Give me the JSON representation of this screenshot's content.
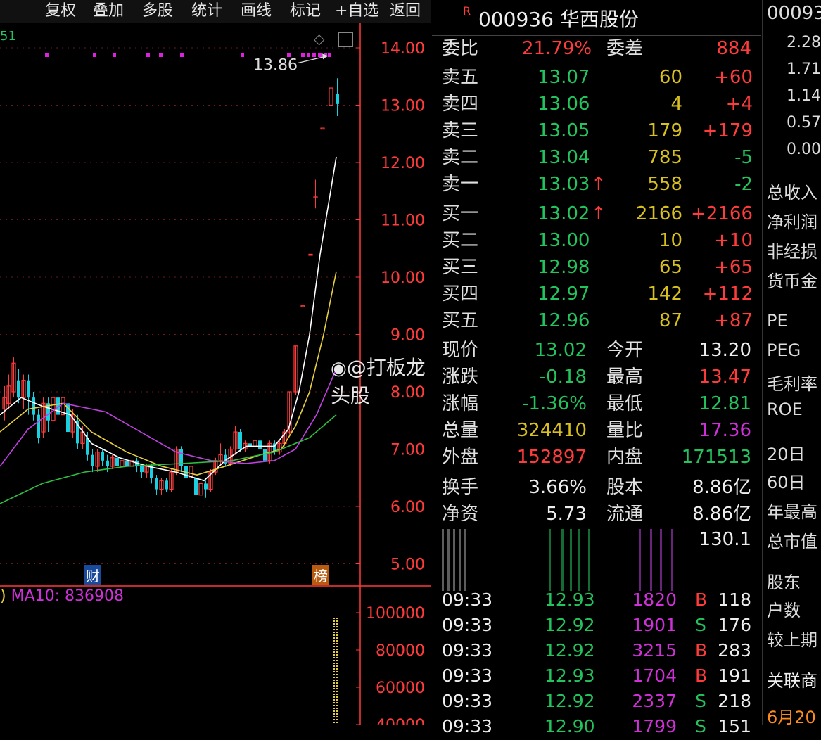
{
  "toolbar": {
    "buttons": [
      "复权",
      "叠加",
      "多股",
      "统计",
      "画线",
      "标记",
      "+自选",
      "返回"
    ]
  },
  "chart": {
    "price_ticks": [
      "14.00",
      "13.00",
      "12.00",
      "11.00",
      "10.00",
      "9.00",
      "8.00",
      "7.00",
      "6.00",
      "5.00"
    ],
    "high_label": "13.86",
    "corner_fragment": "51",
    "badge_cai": "财",
    "badge_bang": "榜",
    "indicator_label": "MA10: 836908",
    "volume_ticks": [
      "100000",
      "80000",
      "60000",
      "40000"
    ],
    "watermark": "@打板龙头股",
    "colors": {
      "up": "#ff3b3b",
      "down": "#1ad0e0",
      "ma5": "#ffffff",
      "ma10": "#e8d040",
      "ma20": "#c040e0",
      "ma60": "#30c040",
      "axis": "#ff3b3b"
    }
  },
  "quote": {
    "code_name": "000936 华西股份",
    "r_mark": "R",
    "weibi_label": "委比",
    "weibi_value": "21.79%",
    "weicha_label": "委差",
    "weicha_value": "884",
    "asks": [
      {
        "label": "卖五",
        "price": "13.07",
        "vol": "60",
        "chg": "+60",
        "arrow": ""
      },
      {
        "label": "卖四",
        "price": "13.06",
        "vol": "4",
        "chg": "+4",
        "arrow": ""
      },
      {
        "label": "卖三",
        "price": "13.05",
        "vol": "179",
        "chg": "+179",
        "arrow": ""
      },
      {
        "label": "卖二",
        "price": "13.04",
        "vol": "785",
        "chg": "-5",
        "arrow": ""
      },
      {
        "label": "卖一",
        "price": "13.03",
        "vol": "558",
        "chg": "-2",
        "arrow": "↑"
      }
    ],
    "bids": [
      {
        "label": "买一",
        "price": "13.02",
        "vol": "2166",
        "chg": "+2166",
        "arrow": "↑"
      },
      {
        "label": "买二",
        "price": "13.00",
        "vol": "10",
        "chg": "+10",
        "arrow": ""
      },
      {
        "label": "买三",
        "price": "12.98",
        "vol": "65",
        "chg": "+65",
        "arrow": ""
      },
      {
        "label": "买四",
        "price": "12.97",
        "vol": "142",
        "chg": "+112",
        "arrow": ""
      },
      {
        "label": "买五",
        "price": "12.96",
        "vol": "87",
        "chg": "+87",
        "arrow": ""
      }
    ],
    "stats": [
      {
        "l1": "现价",
        "v1": "13.02",
        "l2": "今开",
        "v2": "13.20"
      },
      {
        "l1": "涨跌",
        "v1": "-0.18",
        "l2": "最高",
        "v2": "13.47"
      },
      {
        "l1": "涨幅",
        "v1": "-1.36%",
        "l2": "最低",
        "v2": "12.81"
      },
      {
        "l1": "总量",
        "v1": "324410",
        "l2": "量比",
        "v2": "17.36"
      },
      {
        "l1": "外盘",
        "v1": "152897",
        "l2": "内盘",
        "v2": "171513"
      }
    ],
    "stats2": [
      {
        "l1": "换手",
        "v1": "3.66%",
        "l2": "股本",
        "v2": "8.86亿"
      },
      {
        "l1": "净资",
        "v1": "5.73",
        "l2": "流通",
        "v2": "8.86亿"
      }
    ],
    "extra_value": "130.1",
    "ticks": [
      {
        "time": "09:33",
        "price": "12.93",
        "vol": "1820",
        "bs": "B",
        "n": "118"
      },
      {
        "time": "09:33",
        "price": "12.92",
        "vol": "1901",
        "bs": "S",
        "n": "176"
      },
      {
        "time": "09:33",
        "price": "12.92",
        "vol": "3215",
        "bs": "B",
        "n": "283"
      },
      {
        "time": "09:33",
        "price": "12.93",
        "vol": "1704",
        "bs": "B",
        "n": "191"
      },
      {
        "time": "09:33",
        "price": "12.92",
        "vol": "2337",
        "bs": "S",
        "n": "218"
      },
      {
        "time": "09:33",
        "price": "12.90",
        "vol": "1799",
        "bs": "S",
        "n": "151"
      }
    ]
  },
  "rightcol": {
    "code": "00093",
    "values": [
      "2.28",
      "1.71",
      "1.14",
      "0.57",
      "0.00"
    ],
    "labels": [
      "总收入",
      "净利润",
      "非经损",
      "货币金",
      "PE",
      "PEG",
      "毛利率",
      "ROE",
      "20日",
      "60日",
      "年最高",
      "总市值",
      "股东",
      "户数",
      "较上期",
      "关联商",
      "6月20"
    ]
  }
}
